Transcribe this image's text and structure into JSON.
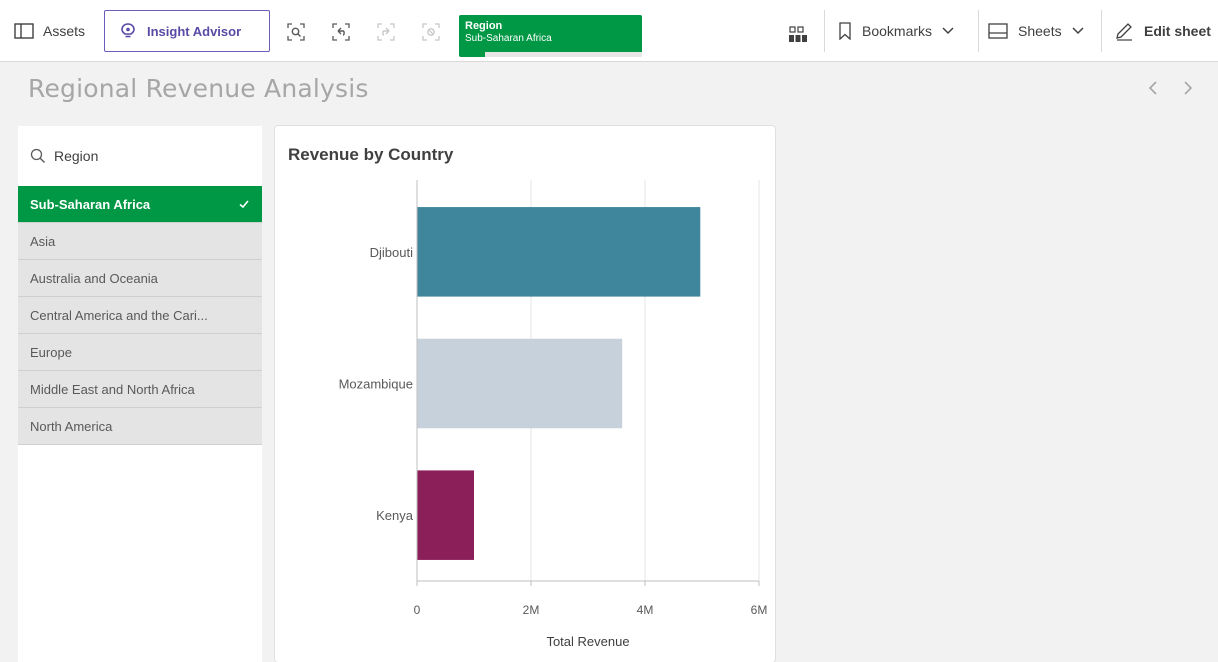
{
  "toolbar": {
    "assets_label": "Assets",
    "insight_label": "Insight Advisor",
    "selection": {
      "field": "Region",
      "value": "Sub-Saharan Africa",
      "fill_fraction": 0.14
    },
    "bookmarks_label": "Bookmarks",
    "sheets_label": "Sheets",
    "edit_label": "Edit sheet"
  },
  "sheet": {
    "title": "Regional Revenue Analysis"
  },
  "filter": {
    "title": "Region",
    "items": [
      {
        "label": "Sub-Saharan Africa",
        "selected": true
      },
      {
        "label": "Asia",
        "selected": false
      },
      {
        "label": "Australia and Oceania",
        "selected": false
      },
      {
        "label": "Central America and the Cari...",
        "selected": false
      },
      {
        "label": "Europe",
        "selected": false
      },
      {
        "label": "Middle East and North Africa",
        "selected": false
      },
      {
        "label": "North America",
        "selected": false
      }
    ]
  },
  "colors": {
    "selection_green": "#009845",
    "insight_purple": "#6e5ab9"
  },
  "chart_data": {
    "type": "bar",
    "orientation": "horizontal",
    "title": "Revenue by Country",
    "categories": [
      "Djibouti",
      "Mozambique",
      "Kenya"
    ],
    "values": [
      4970000,
      3600000,
      1000000
    ],
    "colors": [
      "#3f869d",
      "#c6d1dc",
      "#8a1f5a"
    ],
    "xlabel": "Total Revenue",
    "ylabel": "",
    "xlim": [
      0,
      6000000
    ],
    "ticks": [
      {
        "value": 0,
        "label": "0"
      },
      {
        "value": 2000000,
        "label": "2M"
      },
      {
        "value": 4000000,
        "label": "4M"
      },
      {
        "value": 6000000,
        "label": "6M"
      }
    ],
    "grid": true
  }
}
